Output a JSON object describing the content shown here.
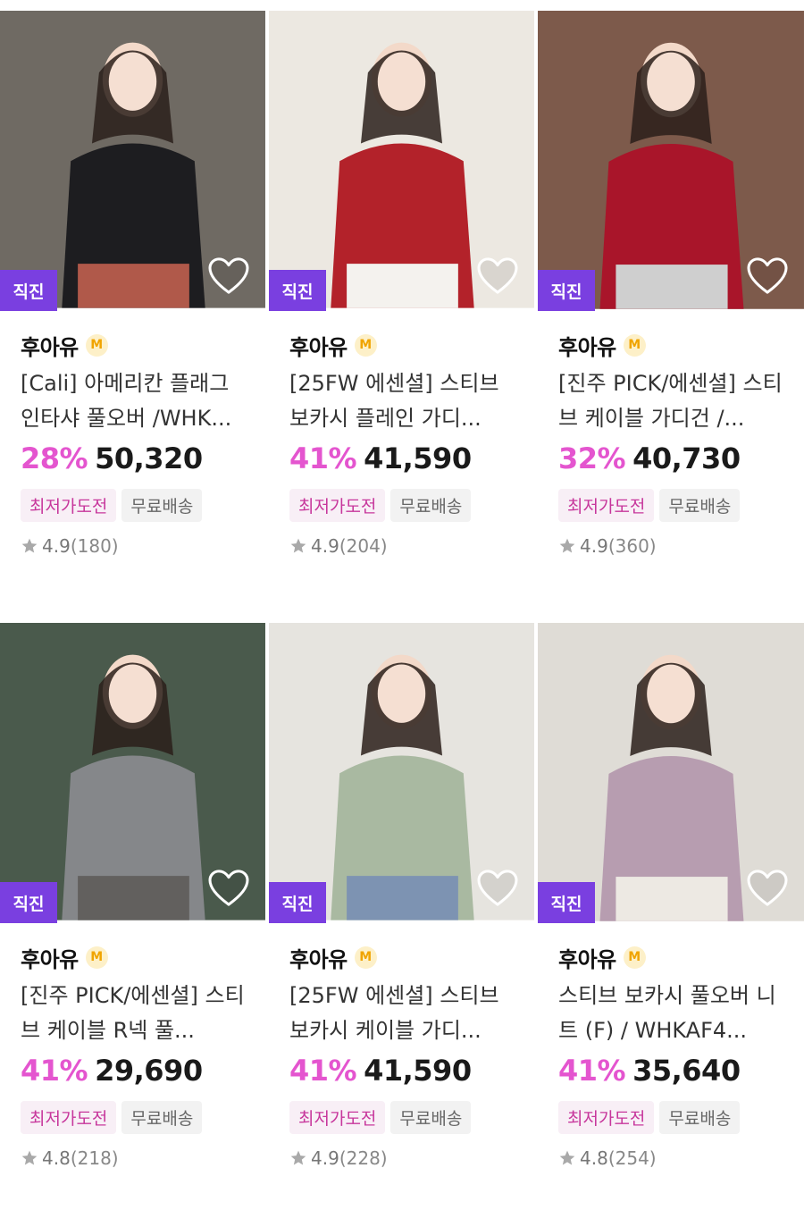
{
  "products": [
    {
      "badge": "직진",
      "brand": "후아유",
      "brand_mark": "M",
      "title": "[Cali] 아메리칸 플래그 인타샤 풀오버 /WHK...",
      "discount": "28%",
      "price": "50,320",
      "tags": [
        "최저가도전",
        "무료배송"
      ],
      "rating": "4.9",
      "review_count": "(180)",
      "photo_colors": [
        "#6f6a63",
        "#1d1d20",
        "#b0594a"
      ]
    },
    {
      "badge": "직진",
      "brand": "후아유",
      "brand_mark": "M",
      "title": "[25FW 에센셜] 스티브 보카시 플레인 가디...",
      "discount": "41%",
      "price": "41,590",
      "tags": [
        "최저가도전",
        "무료배송"
      ],
      "rating": "4.9",
      "review_count": "(204)",
      "photo_colors": [
        "#ece8e1",
        "#b3222a",
        "#f4f2ee"
      ]
    },
    {
      "badge": "직진",
      "brand": "후아유",
      "brand_mark": "M",
      "title": "[진주 PICK/에센셜] 스티브 케이블 가디건 /...",
      "discount": "32%",
      "price": "40,730",
      "tags": [
        "최저가도전",
        "무료배송"
      ],
      "rating": "4.9",
      "review_count": "(360)",
      "photo_colors": [
        "#7d5a4b",
        "#a9152a",
        "#cfcfcf"
      ]
    },
    {
      "badge": "직진",
      "brand": "후아유",
      "brand_mark": "M",
      "title": "[진주 PICK/에센셜] 스티브 케이블 R넥 풀...",
      "discount": "41%",
      "price": "29,690",
      "tags": [
        "최저가도전",
        "무료배송"
      ],
      "rating": "4.8",
      "review_count": "(218)",
      "photo_colors": [
        "#4a5a4c",
        "#85878a",
        "#62605e"
      ]
    },
    {
      "badge": "직진",
      "brand": "후아유",
      "brand_mark": "M",
      "title": "[25FW 에센셜] 스티브 보카시 케이블 가디...",
      "discount": "41%",
      "price": "41,590",
      "tags": [
        "최저가도전",
        "무료배송"
      ],
      "rating": "4.9",
      "review_count": "(228)",
      "photo_colors": [
        "#e6e4df",
        "#a9b9a1",
        "#7d93b2"
      ]
    },
    {
      "badge": "직진",
      "brand": "후아유",
      "brand_mark": "M",
      "title": "스티브 보카시 풀오버 니트 (F) / WHKAF4...",
      "discount": "41%",
      "price": "35,640",
      "tags": [
        "최저가도전",
        "무료배송"
      ],
      "rating": "4.8",
      "review_count": "(254)",
      "photo_colors": [
        "#dfdcd6",
        "#b79db0",
        "#ede9e3"
      ]
    }
  ],
  "colors": {
    "badge_bg": "#7a3fe0",
    "discount": "#e455cf",
    "tag_pink_bg": "#f8eff6",
    "tag_pink_text": "#c7379c",
    "tag_gray_bg": "#f2f2f2"
  },
  "icons": {
    "wishlist": "heart-outline-icon",
    "rating": "star-icon",
    "brand_mark": "membership-badge-icon"
  }
}
